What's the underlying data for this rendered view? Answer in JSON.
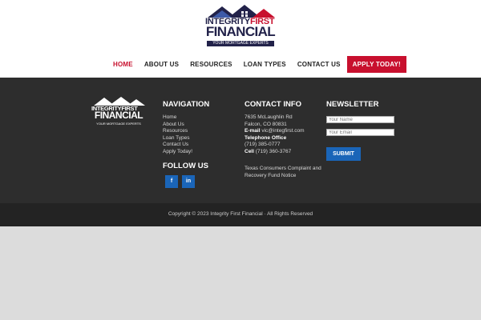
{
  "brand": {
    "logo_line1_a": "INTEGRITY",
    "logo_line1_b": "FIRST",
    "logo_line2": "FINANCIAL",
    "tagline": "YOUR MORTGAGE EXPERTS",
    "colors": {
      "navy": "#22224a",
      "red": "#c8102e",
      "blue": "#1a65b8"
    }
  },
  "nav": {
    "items": [
      "HOME",
      "ABOUT US",
      "RESOURCES",
      "LOAN TYPES",
      "CONTACT US"
    ],
    "cta": "APPLY TODAY!"
  },
  "footer": {
    "navigation": {
      "title": "NAVIGATION",
      "links": [
        "Home",
        "About Us",
        "Resources",
        "Loan Types",
        "Contact Us",
        "Apply Today!"
      ]
    },
    "follow": {
      "title": "FOLLOW US",
      "icons": [
        {
          "name": "facebook-icon",
          "glyph": "f"
        },
        {
          "name": "linkedin-icon",
          "glyph": "in"
        }
      ]
    },
    "contact": {
      "title": "CONTACT INFO",
      "address1": "7635 McLaughlin Rd",
      "address2": "Falcon, CO 80831",
      "email_label": "E-mail",
      "email": "vic@integfirst.com",
      "tel_heading": "Telephone Office",
      "office_phone": "(719) 385-0777",
      "cell_label": "Cell",
      "cell_phone": "(719) 360-3767",
      "notice_line1": "Texas Consumers Complaint and",
      "notice_line2": "Recovery Fund Notice"
    },
    "newsletter": {
      "title": "NEWSLETTER",
      "name_placeholder": "Your Name",
      "email_placeholder": "Your Email",
      "submit": "SUBMIT"
    },
    "copyright": "Copyright © 2023 Integrity First Financial · All Rights Reserved"
  }
}
